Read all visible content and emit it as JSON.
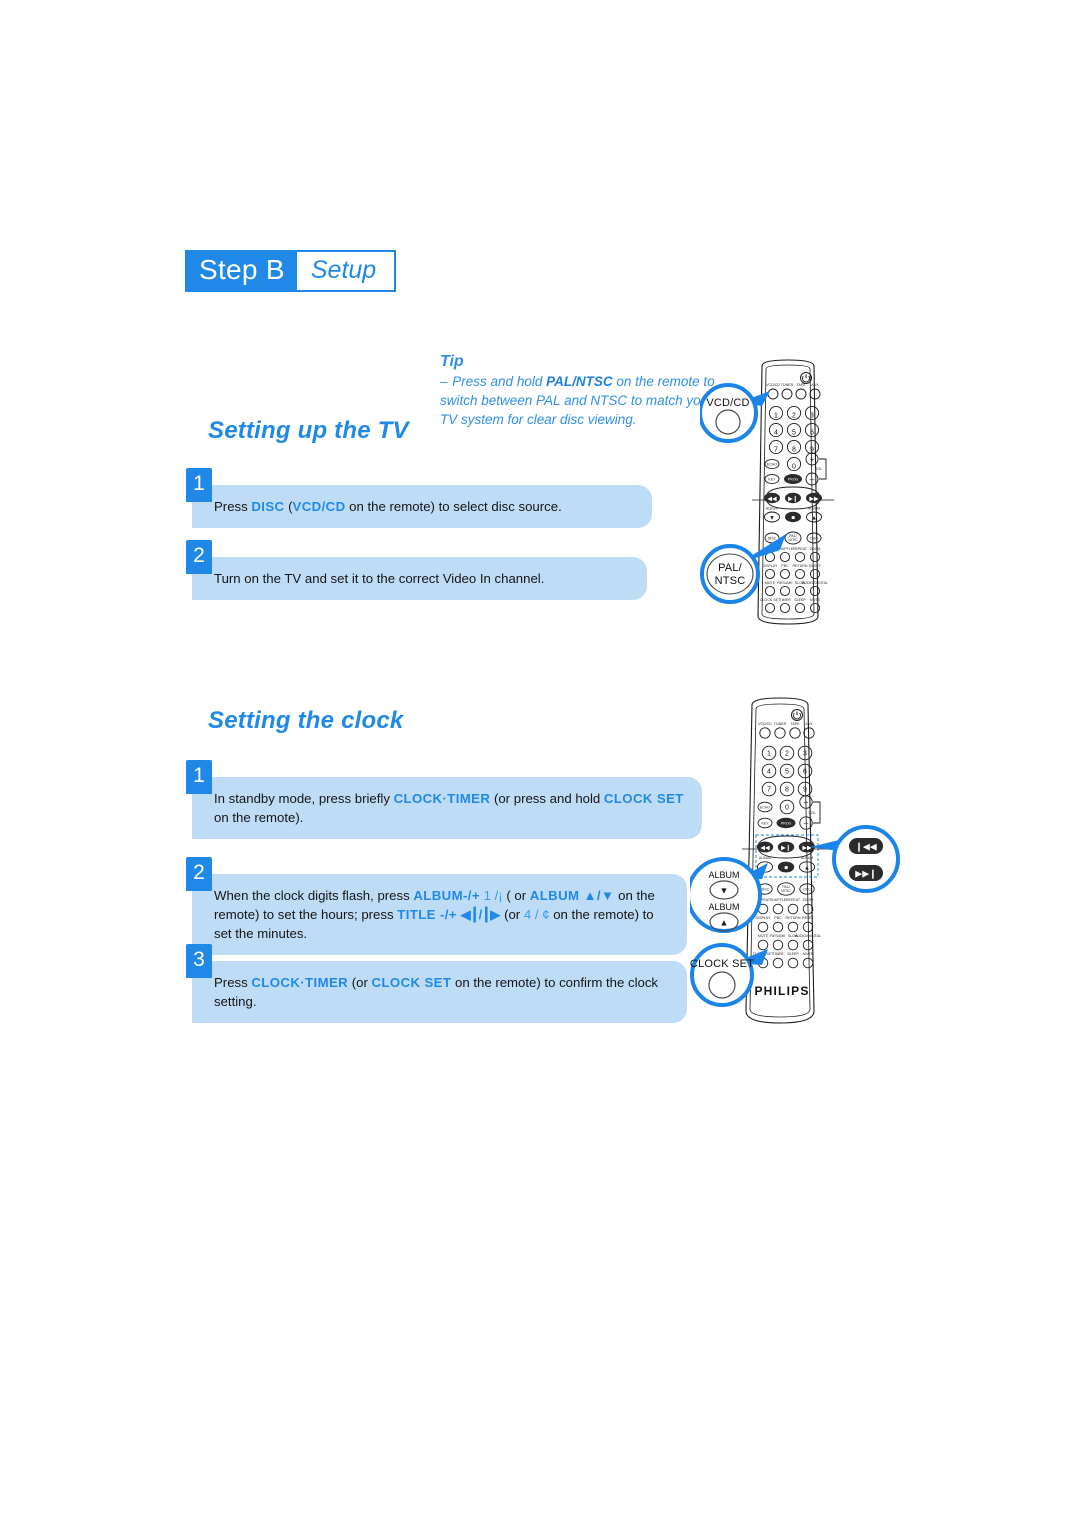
{
  "page": {
    "step_header": {
      "step_label": "Step B",
      "step_word": "Setup"
    }
  },
  "tip": {
    "heading": "Tip",
    "dash": "–",
    "line1_a": "Press and hold ",
    "line1_b": "PAL/NTSC",
    "line1_c": " on the remote",
    "line2": "to switch between PAL and NTSC to match",
    "line3": "your TV system for clear disc viewing."
  },
  "sections": [
    {
      "id": "tv",
      "title": "Setting up the TV",
      "steps": [
        {
          "number": "1",
          "parts": [
            {
              "t": "Press ",
              "style": "normal"
            },
            {
              "t": "DISC",
              "style": "bold"
            },
            {
              "t": " (",
              "style": "normal"
            },
            {
              "t": "VCD/CD",
              "style": "bold"
            },
            {
              "t": " on the remote) to select disc source.",
              "style": "normal"
            }
          ]
        },
        {
          "number": "2",
          "parts": [
            {
              "t": "Turn on the TV and set it to the correct Video In channel.",
              "style": "normal"
            }
          ]
        }
      ]
    },
    {
      "id": "clock",
      "title": "Setting the clock",
      "steps": [
        {
          "number": "1",
          "parts": [
            {
              "t": "In standby mode, press briefly ",
              "style": "normal"
            },
            {
              "t": "CLOCK·TIMER",
              "style": "bold"
            },
            {
              "t": " (or press and hold ",
              "style": "normal"
            },
            {
              "t": "CLOCK SET",
              "style": "bold"
            },
            {
              "t": " on the remote).",
              "style": "normal"
            }
          ]
        },
        {
          "number": "2",
          "parts": [
            {
              "t": "When the clock digits flash, press ",
              "style": "normal"
            },
            {
              "t": "ALBUM-/+",
              "style": "bold"
            },
            {
              "t": " 1",
              "style": "faint"
            },
            {
              "t": "   /¡",
              "style": "faint"
            },
            {
              "t": "   ( or ",
              "style": "normal"
            },
            {
              "t": "ALBUM ▲/▼",
              "style": "bold"
            },
            {
              "t": " on the remote)",
              "style": "normal"
            },
            {
              "t": " to set the hours; press ",
              "style": "normal"
            },
            {
              "t": "TITLE -/+",
              "style": "bold"
            },
            {
              "t": " ◀┃/┃▶",
              "style": "glyph"
            },
            {
              "t": " (or ",
              "style": "normal"
            },
            {
              "t": "4",
              "style": "faint"
            },
            {
              "t": "    / ¢",
              "style": "faint"
            },
            {
              "t": "   on the remote) to set the minutes.",
              "style": "normal"
            }
          ]
        },
        {
          "number": "3",
          "parts": [
            {
              "t": "Press ",
              "style": "normal"
            },
            {
              "t": "CLOCK·TIMER",
              "style": "bold"
            },
            {
              "t": " (or ",
              "style": "normal"
            },
            {
              "t": "CLOCK SET",
              "style": "bold"
            },
            {
              "t": " on the remote) to confirm the clock setting.",
              "style": "normal"
            }
          ]
        }
      ]
    }
  ],
  "remotes": {
    "top": {
      "source_buttons": [
        "VCD/CD",
        "TUNER",
        "TAPE",
        "AUX"
      ],
      "keypad": [
        "1",
        "2",
        "3",
        "4",
        "5",
        "6",
        "7",
        "8",
        "9",
        "0"
      ],
      "side_buttons": [
        "ECHO",
        "KEY",
        "PROG",
        "VOL"
      ],
      "vol_plus": "+",
      "vol_minus": "–",
      "callouts": [
        {
          "label": "VCD/CD"
        },
        {
          "label_line1": "PAL/",
          "label_line2": "NTSC"
        }
      ],
      "bottom_rows": [
        [
          "REPEAT",
          "SHUFFLE",
          "REPEAT",
          "ZOOM"
        ],
        [
          "DISPLAY",
          "PBC",
          "RETURN",
          "RESET"
        ],
        [
          "MUTE",
          "RESUME",
          "SLOW",
          "AUDIO/DIGITAL"
        ],
        [
          "CLOCK SET",
          "TIMER",
          "SLEEP",
          "MUTE"
        ]
      ],
      "album_labels": [
        "ALBUM",
        "ALBUM"
      ],
      "disc_labels": [
        "DISC",
        "PAL/NTSC",
        "OSC"
      ]
    },
    "bottom": {
      "source_buttons": [
        "VCD/CD",
        "TUNER",
        "TAPE",
        "AUX"
      ],
      "keypad": [
        "1",
        "2",
        "3",
        "4",
        "5",
        "6",
        "7",
        "8",
        "9",
        "0"
      ],
      "brand": "PHILIPS",
      "callouts": [
        {
          "label_a": "ALBUM",
          "label_b": "ALBUM"
        },
        {
          "label": "CLOCK SET"
        },
        {
          "icons": [
            "prev-track-icon",
            "next-track-icon"
          ]
        }
      ]
    }
  },
  "colors": {
    "accent_blue": "#2089e8",
    "box_blue": "#bfdcf7",
    "tip_blue": "#2f8fe8",
    "body_text": "#151515",
    "white": "#ffffff"
  },
  "icons": {
    "power": "power-icon",
    "play_pause": "play-pause-icon",
    "stop": "stop-icon",
    "prev": "prev-track-icon",
    "next": "next-track-icon",
    "up": "album-up-icon",
    "down": "album-down-icon"
  }
}
